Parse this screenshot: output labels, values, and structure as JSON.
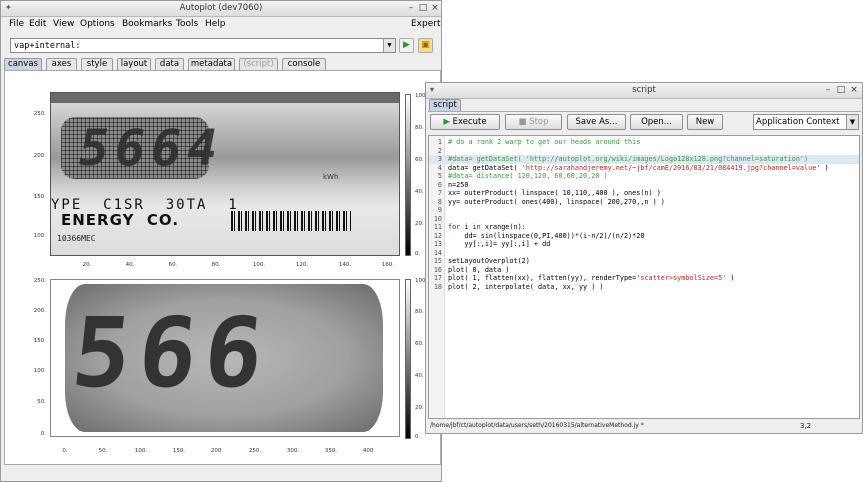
{
  "main": {
    "title": "Autoplot (dev7060)",
    "menu": [
      "File",
      "Edit",
      "View",
      "Options",
      "Bookmarks",
      "Tools",
      "Help"
    ],
    "expert": "Expert",
    "url": "vap+internal:",
    "tabs": [
      "canvas",
      "axes",
      "style",
      "layout",
      "data",
      "metadata",
      "(script)",
      "console"
    ],
    "plot1": {
      "yticks": [
        "250.",
        "200.",
        "150.",
        "100."
      ],
      "xticks": [
        "20.",
        "40.",
        "60.",
        "80.",
        "100.",
        "120.",
        "140.",
        "160."
      ],
      "cticks": [
        "100.",
        "80.",
        "60.",
        "40.",
        "20.",
        "0."
      ],
      "overlay_text": "5664",
      "line1": "YPE  C1SR  30TA  1",
      "line2": "ENERGY  CO.",
      "kwh": "kWh",
      "barcode_text": "10366MEC"
    },
    "plot2": {
      "yticks": [
        "250.",
        "200.",
        "150.",
        "100.",
        "50.",
        "0."
      ],
      "xticks": [
        "0.",
        "50.",
        "100.",
        "150.",
        "200.",
        "250.",
        "300.",
        "350.",
        "400."
      ],
      "cticks": [
        "100.",
        "80.",
        "60.",
        "40.",
        "20.",
        "0."
      ],
      "digits": "566"
    }
  },
  "script": {
    "title": "script",
    "tab": "script",
    "buttons": {
      "execute": "Execute",
      "stop": "Stop",
      "save_as": "Save As...",
      "open": "Open...",
      "new": "New"
    },
    "context": "Application Context",
    "lines": [
      "# do a rank 2 warp to get our heads around this",
      "",
      "#data= getDataSet( 'http://autoplot.org/wiki/images/Logo128x128.png?channel=saturation')",
      "data= getDataSet( 'http://sarahandjeremy.net/~jbf/camE/2016/03/21/084419.jpg?channel=value' )",
      "#data= distance( 120,120, 60,60,20,20 )",
      "n=250",
      "xx= outerProduct( linspace( 10,110,,400 ), ones(n) )",
      "yy= outerProduct( ones(400), linspace( 200,270,,n ) )",
      "",
      "",
      "for i in xrange(n):",
      "    dd= sin(linspace(0,PI,400))*(i-n/2)/(n/2)*20",
      "    yy[:,i]= yy[:,i] + dd",
      "",
      "setLayoutOverplot(2)",
      "plot( 0, data )",
      "plot( 1, flatten(xx), flatten(yy), renderType='scatter>symbolSize=5' )",
      "plot( 2, interpolate( data, xx, yy ) )"
    ],
    "status_path": "/home/jbf/ct/autoplot/data/users/seth/20160315/alternativeMethod.jy *",
    "cursor": "3,2"
  },
  "colors": {
    "comment": "#3a9a3a",
    "string": "#cc2222",
    "keyword": "#2020c0",
    "execute_icon": "#2a9a2a"
  }
}
